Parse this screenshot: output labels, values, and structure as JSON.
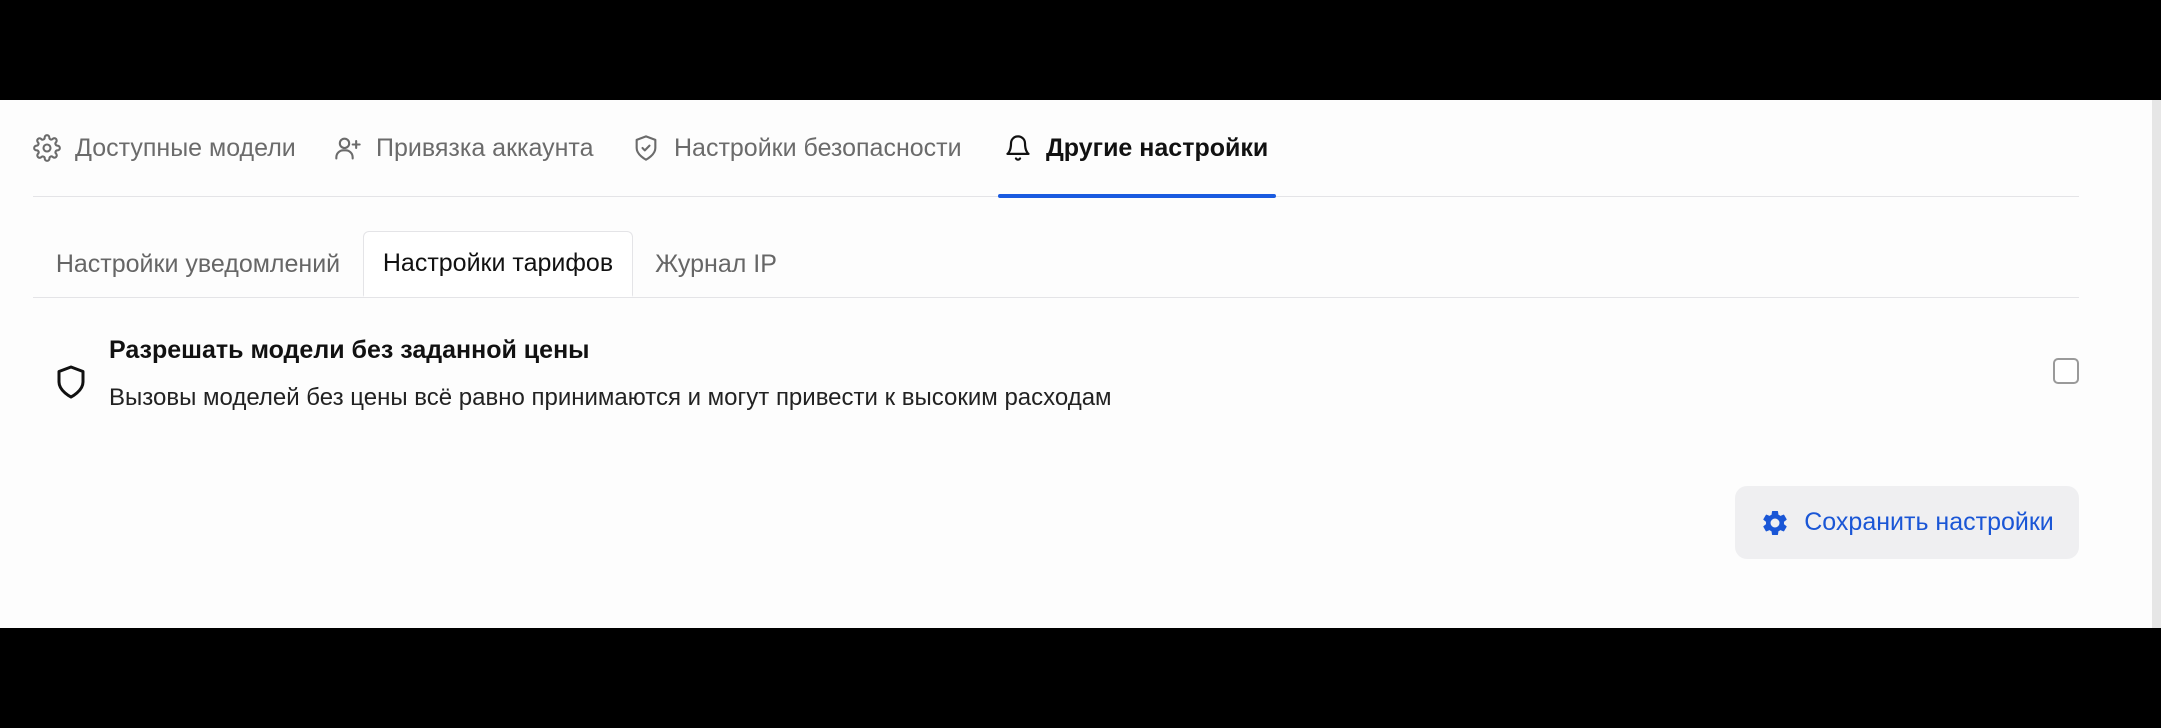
{
  "main_tabs": [
    {
      "label": "Доступные модели",
      "icon": "gear-icon",
      "active": false
    },
    {
      "label": "Привязка аккаунта",
      "icon": "user-plus-icon",
      "active": false
    },
    {
      "label": "Настройки безопасности",
      "icon": "shield-check-icon",
      "active": false
    },
    {
      "label": "Другие настройки",
      "icon": "bell-icon",
      "active": true
    }
  ],
  "sub_tabs": [
    {
      "label": "Настройки уведомлений",
      "active": false
    },
    {
      "label": "Настройки тарифов",
      "active": true
    },
    {
      "label": "Журнал IP",
      "active": false
    }
  ],
  "setting": {
    "icon": "shield-icon",
    "title": "Разрешать модели без заданной цены",
    "description": "Вызовы моделей без цены всё равно принимаются и могут привести к высоким расходам",
    "checked": false
  },
  "save_button": {
    "label": "Сохранить настройки",
    "icon": "gear-icon"
  },
  "colors": {
    "accent": "#1a5be0",
    "button_bg": "#efeff1",
    "divider": "#e4e4e7"
  }
}
